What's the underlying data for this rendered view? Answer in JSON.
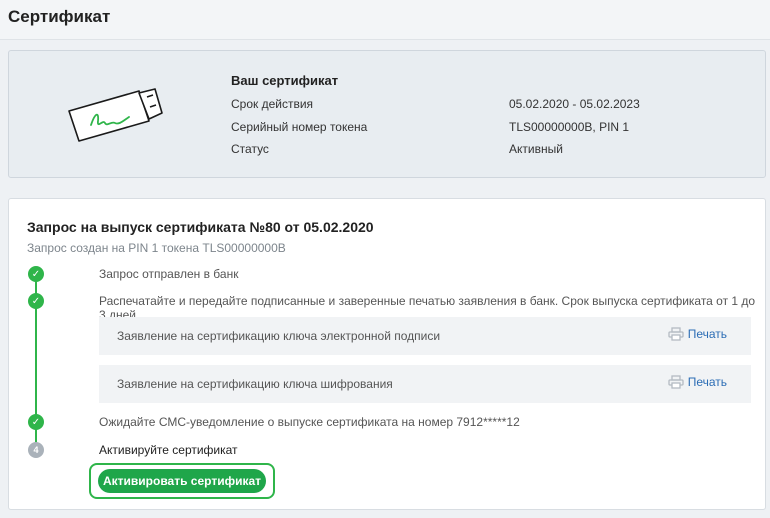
{
  "header": {
    "title": "Сертификат"
  },
  "certificate": {
    "heading": "Ваш сертификат",
    "rows": [
      {
        "label": "Срок действия",
        "value": "05.02.2020 - 05.02.2023"
      },
      {
        "label": "Серийный номер токена",
        "value": "TLS00000000B, PIN 1"
      },
      {
        "label": "Статус",
        "value": "Активный"
      }
    ],
    "illustration_icon": "usb-token-icon"
  },
  "request": {
    "title": "Запрос на выпуск сертификата №80 от 05.02.2020",
    "subtitle": "Запрос создан на PIN 1 токена TLS00000000B",
    "steps": [
      {
        "status": "done",
        "text": "Запрос отправлен в банк"
      },
      {
        "status": "done",
        "text": "Распечатайте и передайте подписанные и заверенные печатью заявления в банк. Срок выпуска сертификата от 1 до 3 дней"
      },
      {
        "status": "done",
        "text": "Ожидайте СМС-уведомление о выпуске сертификата на номер 7912*****12"
      },
      {
        "status": "pending",
        "number": "4",
        "text": "Активируйте сертификат"
      }
    ],
    "documents": [
      {
        "label": "Заявление на сертификацию ключа электронной подписи",
        "action": "Печать"
      },
      {
        "label": "Заявление на сертификацию ключа шифрования",
        "action": "Печать"
      }
    ],
    "activate_button": "Активировать сертификат"
  },
  "colors": {
    "accent_green": "#2fb54a",
    "button_green": "#1fa64a",
    "link_blue": "#2c6db5",
    "pending_gray": "#aab2ba"
  }
}
